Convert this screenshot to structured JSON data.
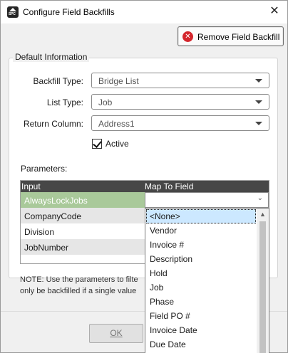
{
  "window": {
    "title": "Configure Field Backfills",
    "app_icon_text": "SPC"
  },
  "toolbar": {
    "remove_label": "Remove Field Backfill"
  },
  "group": {
    "legend": "Default Information"
  },
  "fields": {
    "backfill_type_label": "Backfill Type:",
    "backfill_type_value": "Bridge List",
    "list_type_label": "List Type:",
    "list_type_value": "Job",
    "return_column_label": "Return Column:",
    "return_column_value": "Address1",
    "active_label": "Active",
    "active_checked": true
  },
  "parameters": {
    "label": "Parameters:",
    "columns": [
      "Input",
      "Map To Field"
    ],
    "rows": [
      {
        "input": "AlwaysLockJobs",
        "map": ""
      },
      {
        "input": "CompanyCode",
        "map": ""
      },
      {
        "input": "Division",
        "map": ""
      },
      {
        "input": "JobNumber",
        "map": ""
      }
    ]
  },
  "note": {
    "line1": "NOTE: Use the parameters to filte",
    "line2": "only be backfilled if a single value"
  },
  "dropdown": {
    "items": [
      "<None>",
      "Vendor",
      "Invoice #",
      "Description",
      "Hold",
      "Job",
      "Phase",
      "Field PO #",
      "Invoice Date",
      "Due Date"
    ],
    "selected_index": 0
  },
  "buttons": {
    "ok_label": "OK"
  },
  "colors": {
    "grid_header": "#474747",
    "selected_row": "#a9c99a",
    "alt_row": "#e6e6e6",
    "remove_icon": "#d4262d",
    "dropdown_selected": "#cce8ff"
  }
}
